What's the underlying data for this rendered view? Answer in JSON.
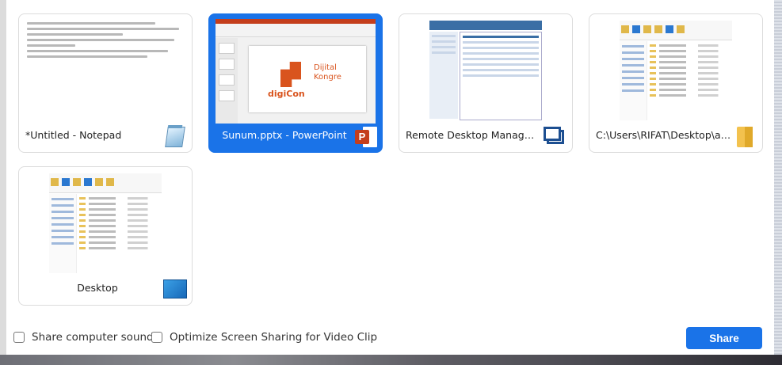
{
  "share_screen_dialog": {
    "windows": [
      {
        "title": "*Untitled - Notepad",
        "icon": "notepad-icon",
        "selected": false
      },
      {
        "title": "Sunum.pptx - PowerPoint",
        "icon": "powerpoint-icon",
        "selected": true,
        "slide_text": {
          "brand_left": "digiCon",
          "brand_right_1": "Dijital",
          "brand_right_2": "Kongre"
        }
      },
      {
        "title": "Remote Desktop Manager Free [...",
        "icon": "remote-desktop-manager-icon",
        "selected": false
      },
      {
        "title": "C:\\Users\\RIFAT\\Desktop\\arkadyas",
        "icon": "folder-icon",
        "selected": false
      },
      {
        "title": "Desktop",
        "icon": "desktop-icon",
        "selected": false
      }
    ],
    "options": {
      "share_sound": {
        "label": "Share computer sound",
        "checked": false
      },
      "optimize_video": {
        "label": "Optimize Screen Sharing for Video Clip",
        "checked": false
      }
    },
    "share_button": "Share",
    "colors": {
      "accent": "#1a73e8",
      "powerpoint": "#c43e1c",
      "folder": "#f3c24e"
    }
  }
}
